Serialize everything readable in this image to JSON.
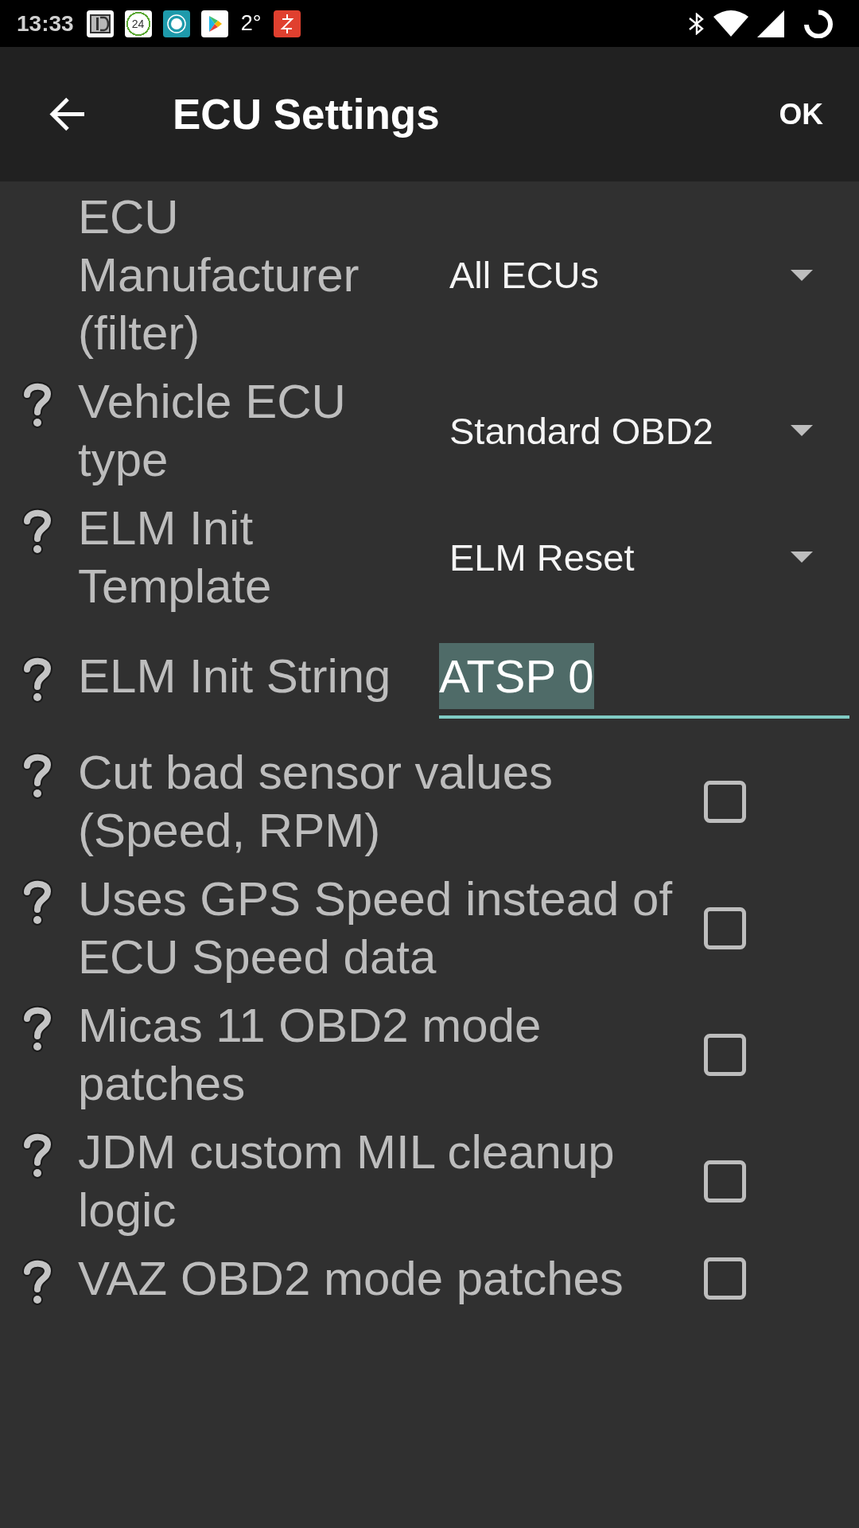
{
  "status_bar": {
    "time": "13:33",
    "day_badge": "24",
    "temperature": "2°"
  },
  "app_bar": {
    "title": "ECU Settings",
    "action": "OK"
  },
  "settings": [
    {
      "kind": "dropdown",
      "label": "ECU Manufacturer (filter)",
      "help": false,
      "value": "All ECUs"
    },
    {
      "kind": "dropdown",
      "label": "Vehicle ECU type",
      "help": true,
      "value": "Standard OBD2"
    },
    {
      "kind": "dropdown",
      "label": "ELM Init Template",
      "help": true,
      "value": "ELM Reset"
    },
    {
      "kind": "text",
      "label": "ELM Init String",
      "help": true,
      "value": "ATSP 0",
      "focused": true,
      "text_selected": true
    },
    {
      "kind": "checkbox",
      "label": "Cut bad sensor values (Speed, RPM)",
      "help": true,
      "checked": false
    },
    {
      "kind": "checkbox",
      "label": "Uses GPS Speed instead of ECU Speed data",
      "help": true,
      "checked": false
    },
    {
      "kind": "checkbox",
      "label": "Micas 11 OBD2 mode patches",
      "help": true,
      "checked": false
    },
    {
      "kind": "checkbox",
      "label": "JDM custom MIL cleanup logic",
      "help": true,
      "checked": false
    },
    {
      "kind": "checkbox",
      "label": "VAZ OBD2 mode patches",
      "help": true,
      "checked": false
    }
  ]
}
